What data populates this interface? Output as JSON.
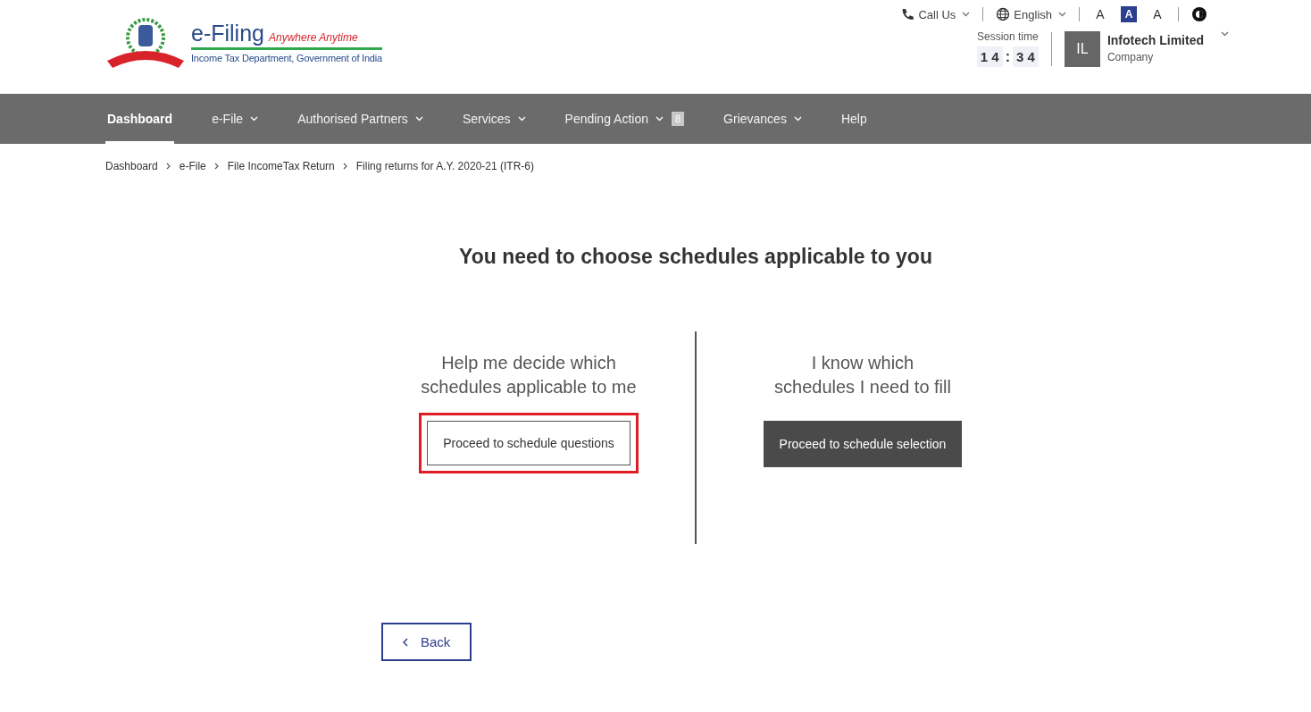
{
  "header": {
    "logo": {
      "title": "e-Filing",
      "tagline": "Anywhere Anytime",
      "subtitle": "Income Tax Department, Government of India"
    },
    "utility": [
      {
        "kind": "phone",
        "label": "Call Us",
        "dropdown": true
      },
      {
        "kind": "globe",
        "label": "English",
        "dropdown": true
      },
      {
        "kind": "font-smaller",
        "label": "A",
        "selected": false
      },
      {
        "kind": "font-normal",
        "label": "A",
        "selected": true
      },
      {
        "kind": "font-larger",
        "label": "A",
        "selected": false
      },
      {
        "kind": "contrast"
      }
    ],
    "session": {
      "label": "Session time",
      "minutes": "1 4",
      "separator": ":",
      "seconds": "3 4"
    },
    "user": {
      "initials": "IL",
      "name": "Infotech Limited",
      "role": "Company"
    }
  },
  "nav": [
    {
      "label": "Dashboard",
      "selected": true,
      "dropdown": false
    },
    {
      "label": "e-File",
      "selected": false,
      "dropdown": true
    },
    {
      "label": "Authorised Partners",
      "selected": false,
      "dropdown": true
    },
    {
      "label": "Services",
      "selected": false,
      "dropdown": true
    },
    {
      "label": "Pending Action",
      "selected": false,
      "dropdown": true,
      "badge": "8"
    },
    {
      "label": "Grievances",
      "selected": false,
      "dropdown": true
    },
    {
      "label": "Help",
      "selected": false,
      "dropdown": false
    }
  ],
  "breadcrumb": [
    "Dashboard",
    "e-File",
    "File IncomeTax Return",
    "Filing returns for A.Y. 2020-21 (ITR-6)"
  ],
  "heading": "You need to choose schedules applicable to you",
  "options": [
    {
      "text": "Help me decide which schedules applicable to me",
      "button": "Proceed to schedule questions",
      "kind": "outline",
      "highlighted": true
    },
    {
      "text": "I know which schedules I need to fill",
      "button": "Proceed to schedule selection",
      "kind": "filled",
      "highlighted": false
    }
  ],
  "back_button": {
    "label": "Back"
  }
}
